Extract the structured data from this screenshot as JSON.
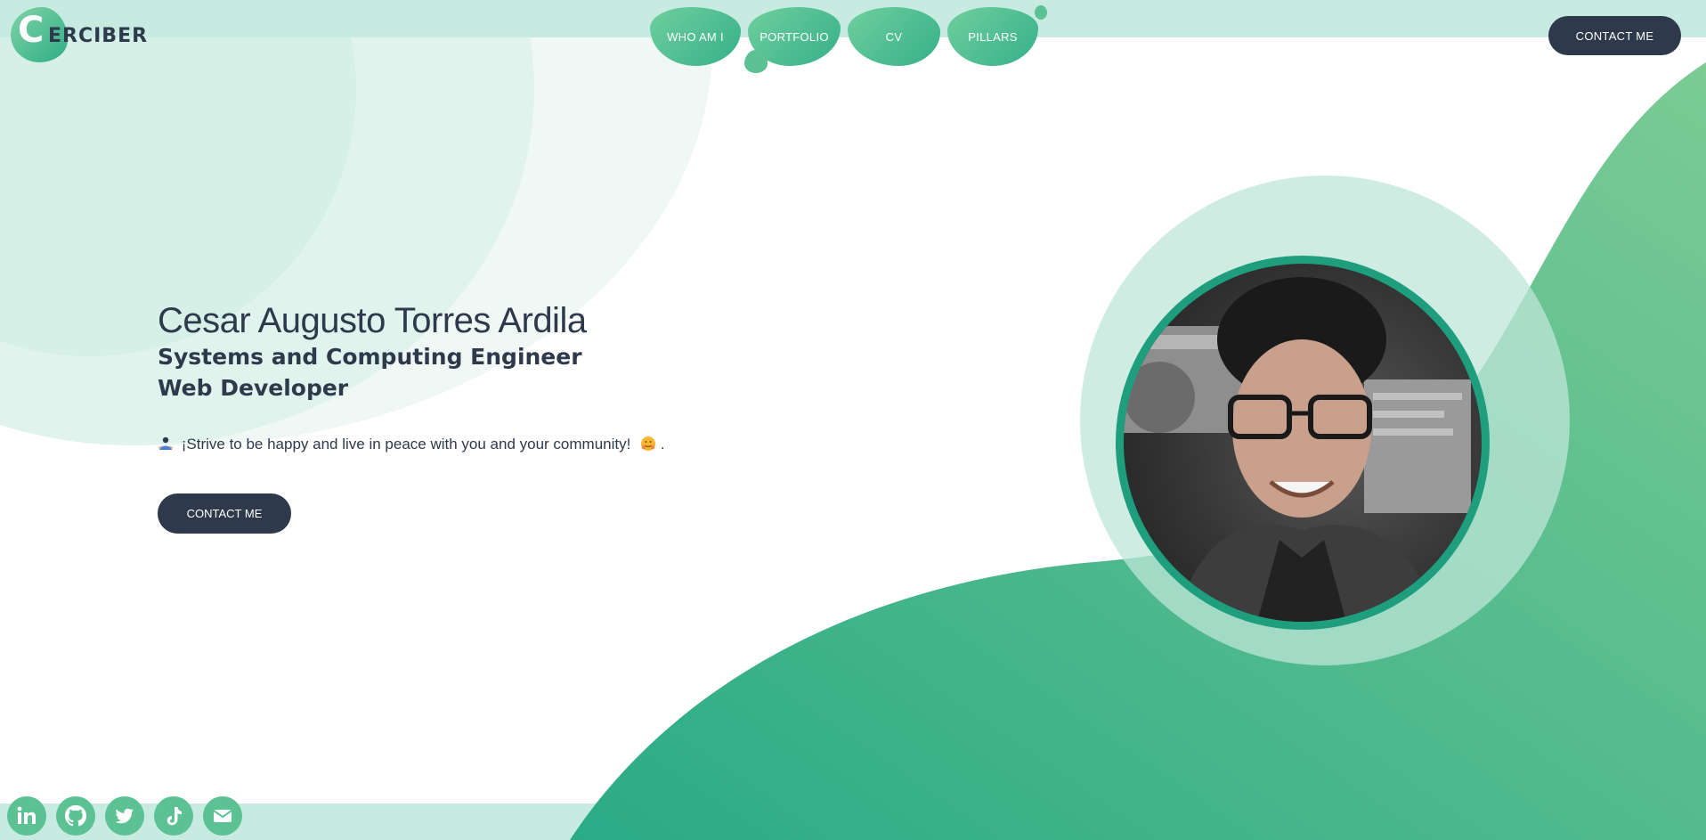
{
  "logo": {
    "letter": "C",
    "text": "ERCIBER"
  },
  "nav": {
    "items": [
      {
        "label": "WHO AM I"
      },
      {
        "label": "PORTFOLIO"
      },
      {
        "label": "CV"
      },
      {
        "label": "PILLARS"
      }
    ],
    "contact_label": "CONTACT ME"
  },
  "hero": {
    "name": "Cesar Augusto Torres Ardila",
    "role_1": "Systems and Computing Engineer",
    "role_2": "Web Developer",
    "tagline": "¡Strive to be happy and live in peace with you and your community!",
    "tagline_end": ".",
    "contact_label": "CONTACT ME"
  },
  "photo": {
    "icon": "portrait"
  },
  "socials": [
    {
      "icon": "linkedin-icon"
    },
    {
      "icon": "github-icon"
    },
    {
      "icon": "twitter-icon"
    },
    {
      "icon": "tiktok-icon"
    },
    {
      "icon": "mail-icon"
    }
  ],
  "colors": {
    "accent_green": "#3bb38a",
    "dark_navy": "#2e3a4b",
    "mint": "#c8ebe1"
  }
}
